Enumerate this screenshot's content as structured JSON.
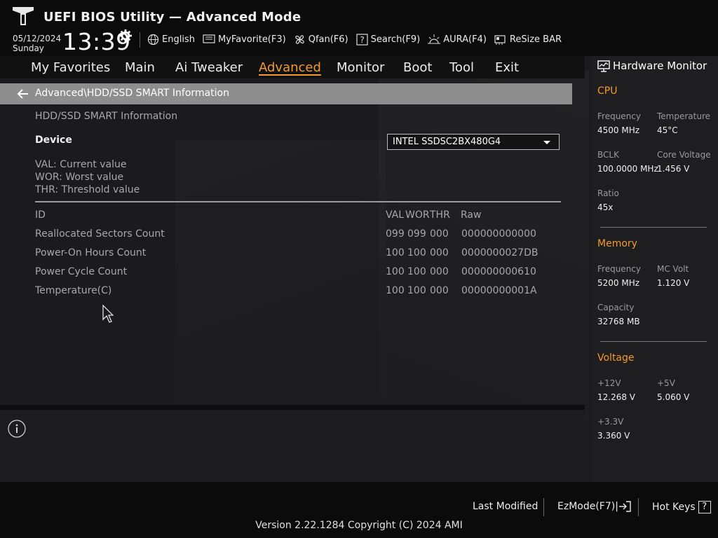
{
  "header": {
    "title": "UEFI BIOS Utility — Advanced Mode",
    "date": "05/12/2024",
    "day": "Sunday",
    "time": "13:39",
    "toolbar": [
      {
        "label": "English",
        "icon": "globe-icon"
      },
      {
        "label": "MyFavorite(F3)",
        "icon": "favorite-icon"
      },
      {
        "label": "Qfan(F6)",
        "icon": "fan-icon"
      },
      {
        "label": "Search(F9)",
        "icon": "search-icon"
      },
      {
        "label": "AURA(F4)",
        "icon": "aura-icon"
      },
      {
        "label": "ReSize BAR",
        "icon": "resize-bar-icon"
      }
    ]
  },
  "menu": {
    "items": [
      "My Favorites",
      "Main",
      "Ai Tweaker",
      "Advanced",
      "Monitor",
      "Boot",
      "Tool",
      "Exit"
    ],
    "active": "Advanced"
  },
  "breadcrumb": "Advanced\\HDD/SSD SMART Information",
  "page": {
    "section_title": "HDD/SSD SMART Information",
    "device_label": "Device",
    "device_value": "INTEL SSDSC2BX480G4",
    "legend": [
      "VAL:  Current value",
      "WOR: Worst value",
      "THR:  Threshold value"
    ]
  },
  "smart_table": {
    "headers": [
      "ID",
      "VAL",
      "WOR",
      "THR",
      "Raw"
    ],
    "rows": [
      {
        "id": "Reallocated Sectors Count",
        "val": "099",
        "wor": "099",
        "thr": "000",
        "raw": "000000000000"
      },
      {
        "id": "Power-On Hours Count",
        "val": "100",
        "wor": "100",
        "thr": "000",
        "raw": "0000000027DB"
      },
      {
        "id": "Power Cycle Count",
        "val": "100",
        "wor": "100",
        "thr": "000",
        "raw": "000000000610"
      },
      {
        "id": "Temperature(C)",
        "val": "100",
        "wor": "100",
        "thr": "000",
        "raw": "00000000001A"
      }
    ]
  },
  "hardware_monitor": {
    "title": "Hardware Monitor",
    "cpu": {
      "title": "CPU",
      "frequency_label": "Frequency",
      "frequency": "4500 MHz",
      "temperature_label": "Temperature",
      "temperature": "45°C",
      "bclk_label": "BCLK",
      "bclk": "100.0000 MHz",
      "core_voltage_label": "Core Voltage",
      "core_voltage": "1.456 V",
      "ratio_label": "Ratio",
      "ratio": "45x"
    },
    "memory": {
      "title": "Memory",
      "frequency_label": "Frequency",
      "frequency": "5200 MHz",
      "mc_volt_label": "MC Volt",
      "mc_volt": "1.120 V",
      "capacity_label": "Capacity",
      "capacity": "32768 MB"
    },
    "voltage": {
      "title": "Voltage",
      "v12_label": "+12V",
      "v12": "12.268 V",
      "v5_label": "+5V",
      "v5": "5.060 V",
      "v33_label": "+3.3V",
      "v33": "3.360 V"
    }
  },
  "footer": {
    "last_modified": "Last Modified",
    "ezmode": "EzMode(F7)|",
    "hot_keys": "Hot Keys",
    "hot_keys_key": "?",
    "version": "Version 2.22.1284 Copyright (C) 2024 AMI"
  },
  "colors": {
    "accent": "#f29a2e",
    "header_bg": "#0b0b0c",
    "body_bg": "#1b1b1d",
    "breadcrumb_bg": "#8e8e8e"
  }
}
